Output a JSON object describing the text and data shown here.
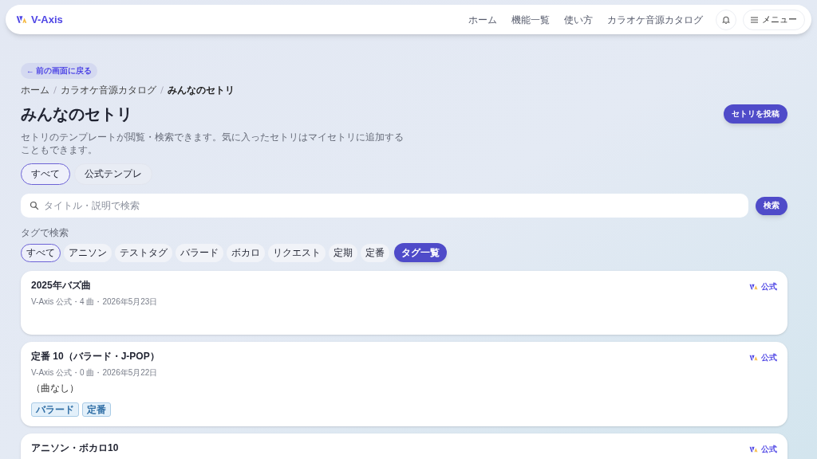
{
  "header": {
    "brand": "V-Axis",
    "nav": [
      "ホーム",
      "機能一覧",
      "使い方",
      "カラオケ音源カタログ"
    ],
    "menu_button": "メニュー"
  },
  "back_link": "← 前の画面に戻る",
  "breadcrumb": [
    {
      "label": "ホーム",
      "current": false
    },
    {
      "label": "カラオケ音源カタログ",
      "current": false
    },
    {
      "label": "みんなのセトリ",
      "current": true
    }
  ],
  "title": "みんなのセトリ",
  "post_button": "セトリを投稿",
  "description": "セトリのテンプレートが閲覧・検索できます。気に入ったセトリはマイセトリに追加することもできます。",
  "tabs": [
    {
      "label": "すべて",
      "selected": true
    },
    {
      "label": "公式テンプレ",
      "selected": false
    }
  ],
  "search": {
    "placeholder": "タイトル・説明で検索",
    "button": "検索"
  },
  "tag_filter": {
    "label": "タグで検索",
    "tags": [
      {
        "label": "すべて",
        "selected": true
      },
      {
        "label": "アニソン",
        "selected": false
      },
      {
        "label": "テストタグ",
        "selected": false
      },
      {
        "label": "バラード",
        "selected": false
      },
      {
        "label": "ボカロ",
        "selected": false
      },
      {
        "label": "リクエスト",
        "selected": false
      },
      {
        "label": "定期",
        "selected": false
      },
      {
        "label": "定番",
        "selected": false
      }
    ],
    "all_tags_button": "タグ一覧"
  },
  "setlists": [
    {
      "title": "2025年バズ曲",
      "meta": "V-Axis 公式・4 曲・2026年5月23日",
      "badge": "公式"
    },
    {
      "title": "定番 10（バラード・J-POP）",
      "meta": "V-Axis 公式・0 曲・2026年5月22日",
      "empty_note": "（曲なし）",
      "badge": "公式",
      "tags": [
        "バラード",
        "定番"
      ]
    },
    {
      "title": "アニソン・ボカロ10",
      "badge": "公式"
    }
  ]
}
